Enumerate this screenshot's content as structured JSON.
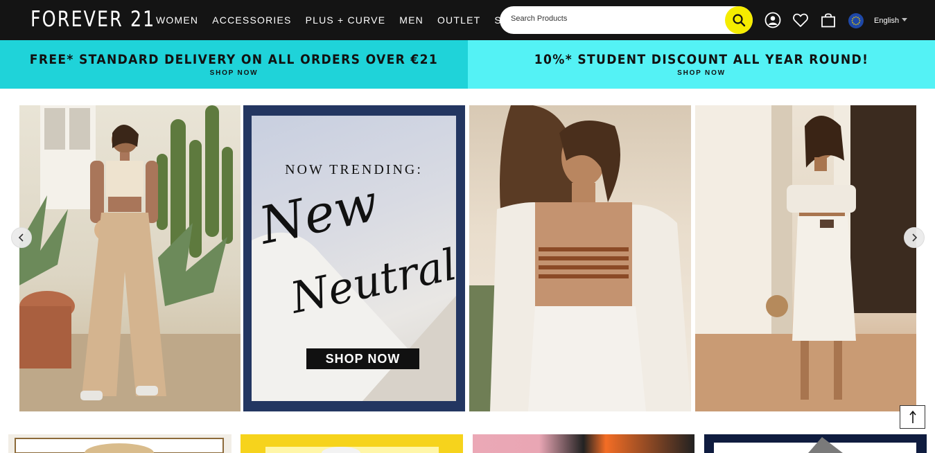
{
  "header": {
    "logo": "FOREVER 21",
    "nav": [
      "WOMEN",
      "ACCESSORIES",
      "PLUS + CURVE",
      "MEN",
      "OUTLET",
      "SALE"
    ],
    "search_placeholder": "Search Products",
    "language": "English",
    "icons": [
      "search-icon",
      "account-icon",
      "wishlist-heart-icon",
      "shopping-bag-icon",
      "eu-flag-icon",
      "chevron-down-icon"
    ]
  },
  "promos": [
    {
      "title": "FREE* STANDARD DELIVERY ON ALL ORDERS OVER €21",
      "link": "SHOP NOW",
      "color": "#1fd3d9"
    },
    {
      "title": "10%* STUDENT DISCOUNT ALL YEAR ROUND!",
      "link": "SHOP NOW",
      "color": "#54f2f5"
    }
  ],
  "carousel": {
    "feature": {
      "kicker": "NOW TRENDING:",
      "script_line1": "New",
      "script_line2": "Neutrals",
      "button": "SHOP NOW"
    }
  },
  "colors": {
    "header_bg": "#141414",
    "search_button": "#f5ec00",
    "accent_black": "#111111"
  }
}
